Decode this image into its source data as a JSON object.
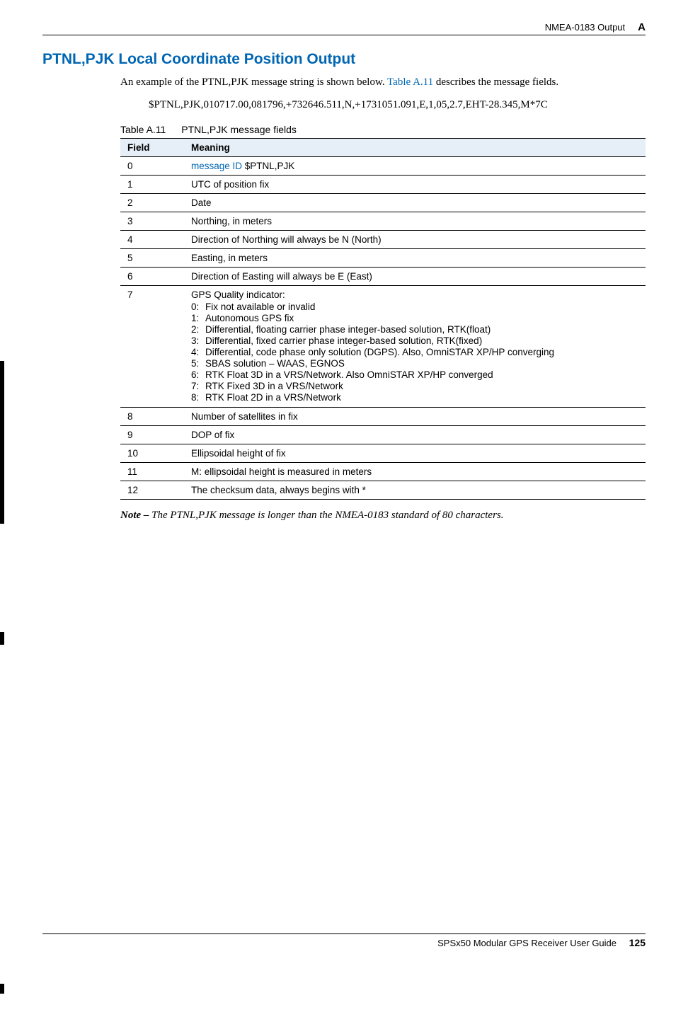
{
  "header": {
    "section": "NMEA-0183 Output",
    "appendix": "A"
  },
  "title": {
    "code": "PTNL,PJK",
    "rest": " Local Coordinate Position Output"
  },
  "intro": {
    "pre": "An example of the PTNL,PJK message string is shown below. ",
    "link": "Table A.11",
    "post": " describes the message fields."
  },
  "example": "$PTNL,PJK,010717.00,081796,+732646.511,N,+1731051.091,E,1,05,2.7,EHT-28.345,M*7C",
  "table": {
    "caption_num": "Table A.11",
    "caption_text": "PTNL,PJK message fields",
    "head_field": "Field",
    "head_meaning": "Meaning",
    "row0_field": "0",
    "row0_link": "message ID",
    "row0_rest": " $PTNL,PJK",
    "rows": [
      {
        "f": "1",
        "m": "UTC of position fix"
      },
      {
        "f": "2",
        "m": "Date"
      },
      {
        "f": "3",
        "m": "Northing, in meters"
      },
      {
        "f": "4",
        "m": "Direction of Northing will always be N (North)"
      },
      {
        "f": "5",
        "m": "Easting, in meters"
      },
      {
        "f": "6",
        "m": "Direction of Easting will always be E (East)"
      }
    ],
    "row7_field": "7",
    "row7_head": "GPS Quality indicator:",
    "row7_items": [
      {
        "n": "0:",
        "t": "Fix not available or invalid"
      },
      {
        "n": "1:",
        "t": "Autonomous GPS fix"
      },
      {
        "n": "2:",
        "t": "Differential, floating carrier phase integer-based solution, RTK(float)"
      },
      {
        "n": "3:",
        "t": "Differential, fixed carrier phase integer-based solution, RTK(fixed)"
      },
      {
        "n": "4:",
        "t": "Differential, code phase only solution (DGPS). Also, OmniSTAR XP/HP converging"
      },
      {
        "n": "5:",
        "t": "SBAS solution – WAAS, EGNOS"
      },
      {
        "n": "6:",
        "t": "RTK Float 3D in a VRS/Network. Also OmniSTAR XP/HP converged"
      },
      {
        "n": "7:",
        "t": "RTK Fixed 3D in a VRS/Network"
      },
      {
        "n": "8:",
        "t": "RTK Float 2D in a VRS/Network"
      }
    ],
    "rows2": [
      {
        "f": "8",
        "m": "Number of satellites in fix"
      },
      {
        "f": "9",
        "m": "DOP of fix"
      },
      {
        "f": "10",
        "m": "Ellipsoidal height of fix"
      },
      {
        "f": "11",
        "m": "M: ellipsoidal height is measured in meters"
      },
      {
        "f": "12",
        "m": "The checksum data, always begins with *"
      }
    ]
  },
  "note": {
    "label": "Note – ",
    "text": "The PTNL,PJK message is longer than the NMEA-0183 standard of 80 characters."
  },
  "footer": {
    "guide": "SPSx50 Modular GPS Receiver User Guide",
    "page": "125"
  }
}
